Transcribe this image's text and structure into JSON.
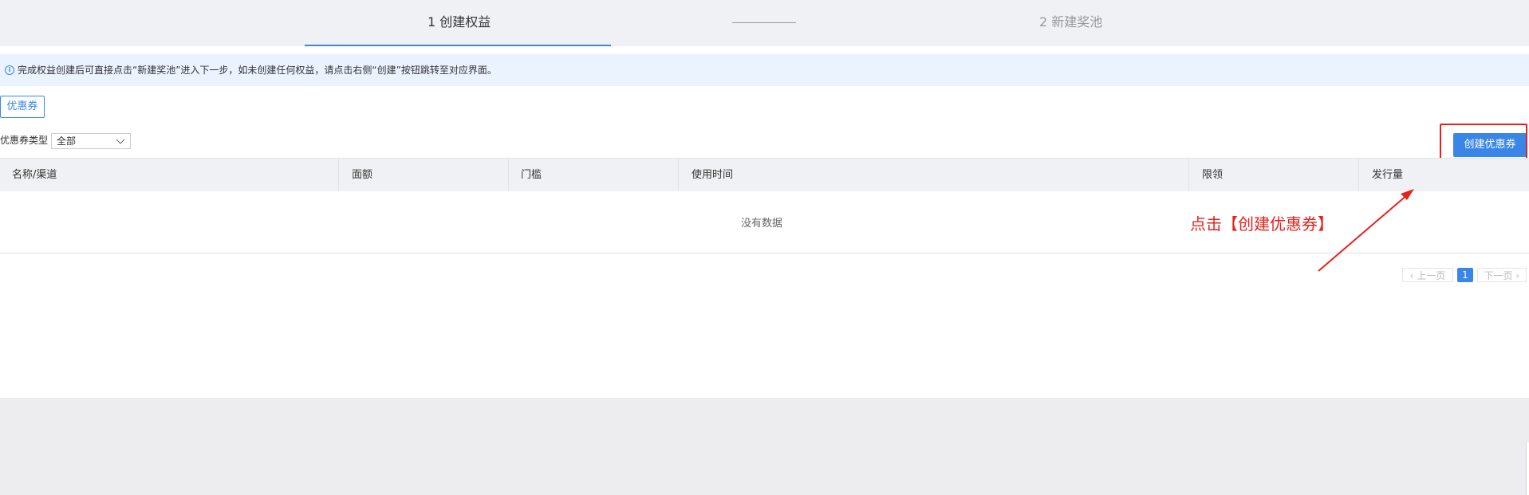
{
  "steps": {
    "step1": "1 创建权益",
    "step2": "2 新建奖池"
  },
  "notice": {
    "icon": "info-icon",
    "text": "完成权益创建后可直接点击“新建奖池”进入下一步，如未创建任何权益，请点击右侧“创建”按钮跳转至对应界面。"
  },
  "tabs": {
    "coupon": "优惠券"
  },
  "filter": {
    "label": "优惠券类型",
    "selected": "全部"
  },
  "actions": {
    "create_coupon": "创建优惠券"
  },
  "table": {
    "columns": [
      "名称/渠道",
      "面额",
      "门槛",
      "使用时间",
      "限领",
      "发行量"
    ],
    "empty_text": "没有数据"
  },
  "pagination": {
    "prev": "上一页",
    "current": "1",
    "next": "下一页"
  },
  "annotation": {
    "text": "点击【创建优惠券】",
    "color": "#e8211c"
  },
  "colors": {
    "accent": "#3a86e8",
    "annotation": "#e8211c"
  }
}
